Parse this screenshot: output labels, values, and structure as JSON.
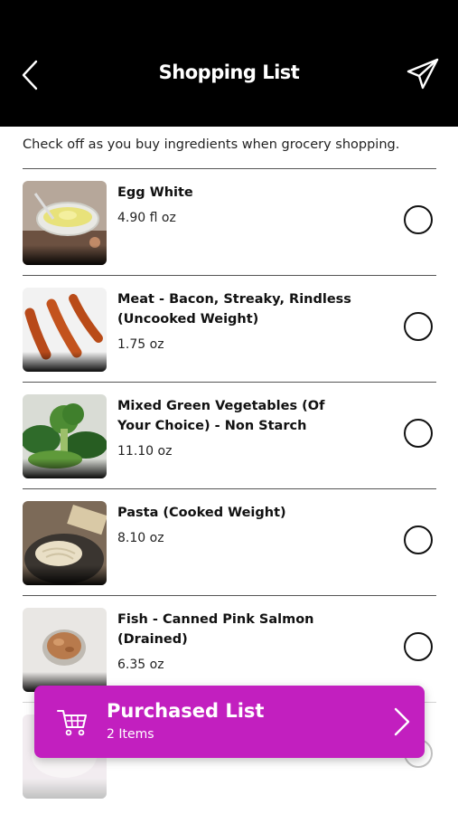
{
  "header": {
    "title": "Shopping List",
    "back_icon": "chevron-left-icon",
    "send_icon": "paper-plane-icon"
  },
  "instructions": "Check off as you buy ingredients when grocery shopping.",
  "items": [
    {
      "name": "Egg White",
      "quantity": "4.90 fl oz"
    },
    {
      "name": "Meat - Bacon, Streaky, Rindless (Uncooked Weight)",
      "quantity": "1.75 oz"
    },
    {
      "name": "Mixed Green Vegetables (Of Your Choice) - Non Starch",
      "quantity": "11.10 oz"
    },
    {
      "name": "Pasta (Cooked Weight)",
      "quantity": "8.10 oz"
    },
    {
      "name": "Fish - Canned Pink Salmon (Drained)",
      "quantity": "6.35 oz"
    }
  ],
  "purchased": {
    "title": "Purchased List",
    "count": "2 Items",
    "color": "#c21fbf"
  },
  "colors": {
    "header_bg": "#000000",
    "accent": "#c21fbf"
  }
}
